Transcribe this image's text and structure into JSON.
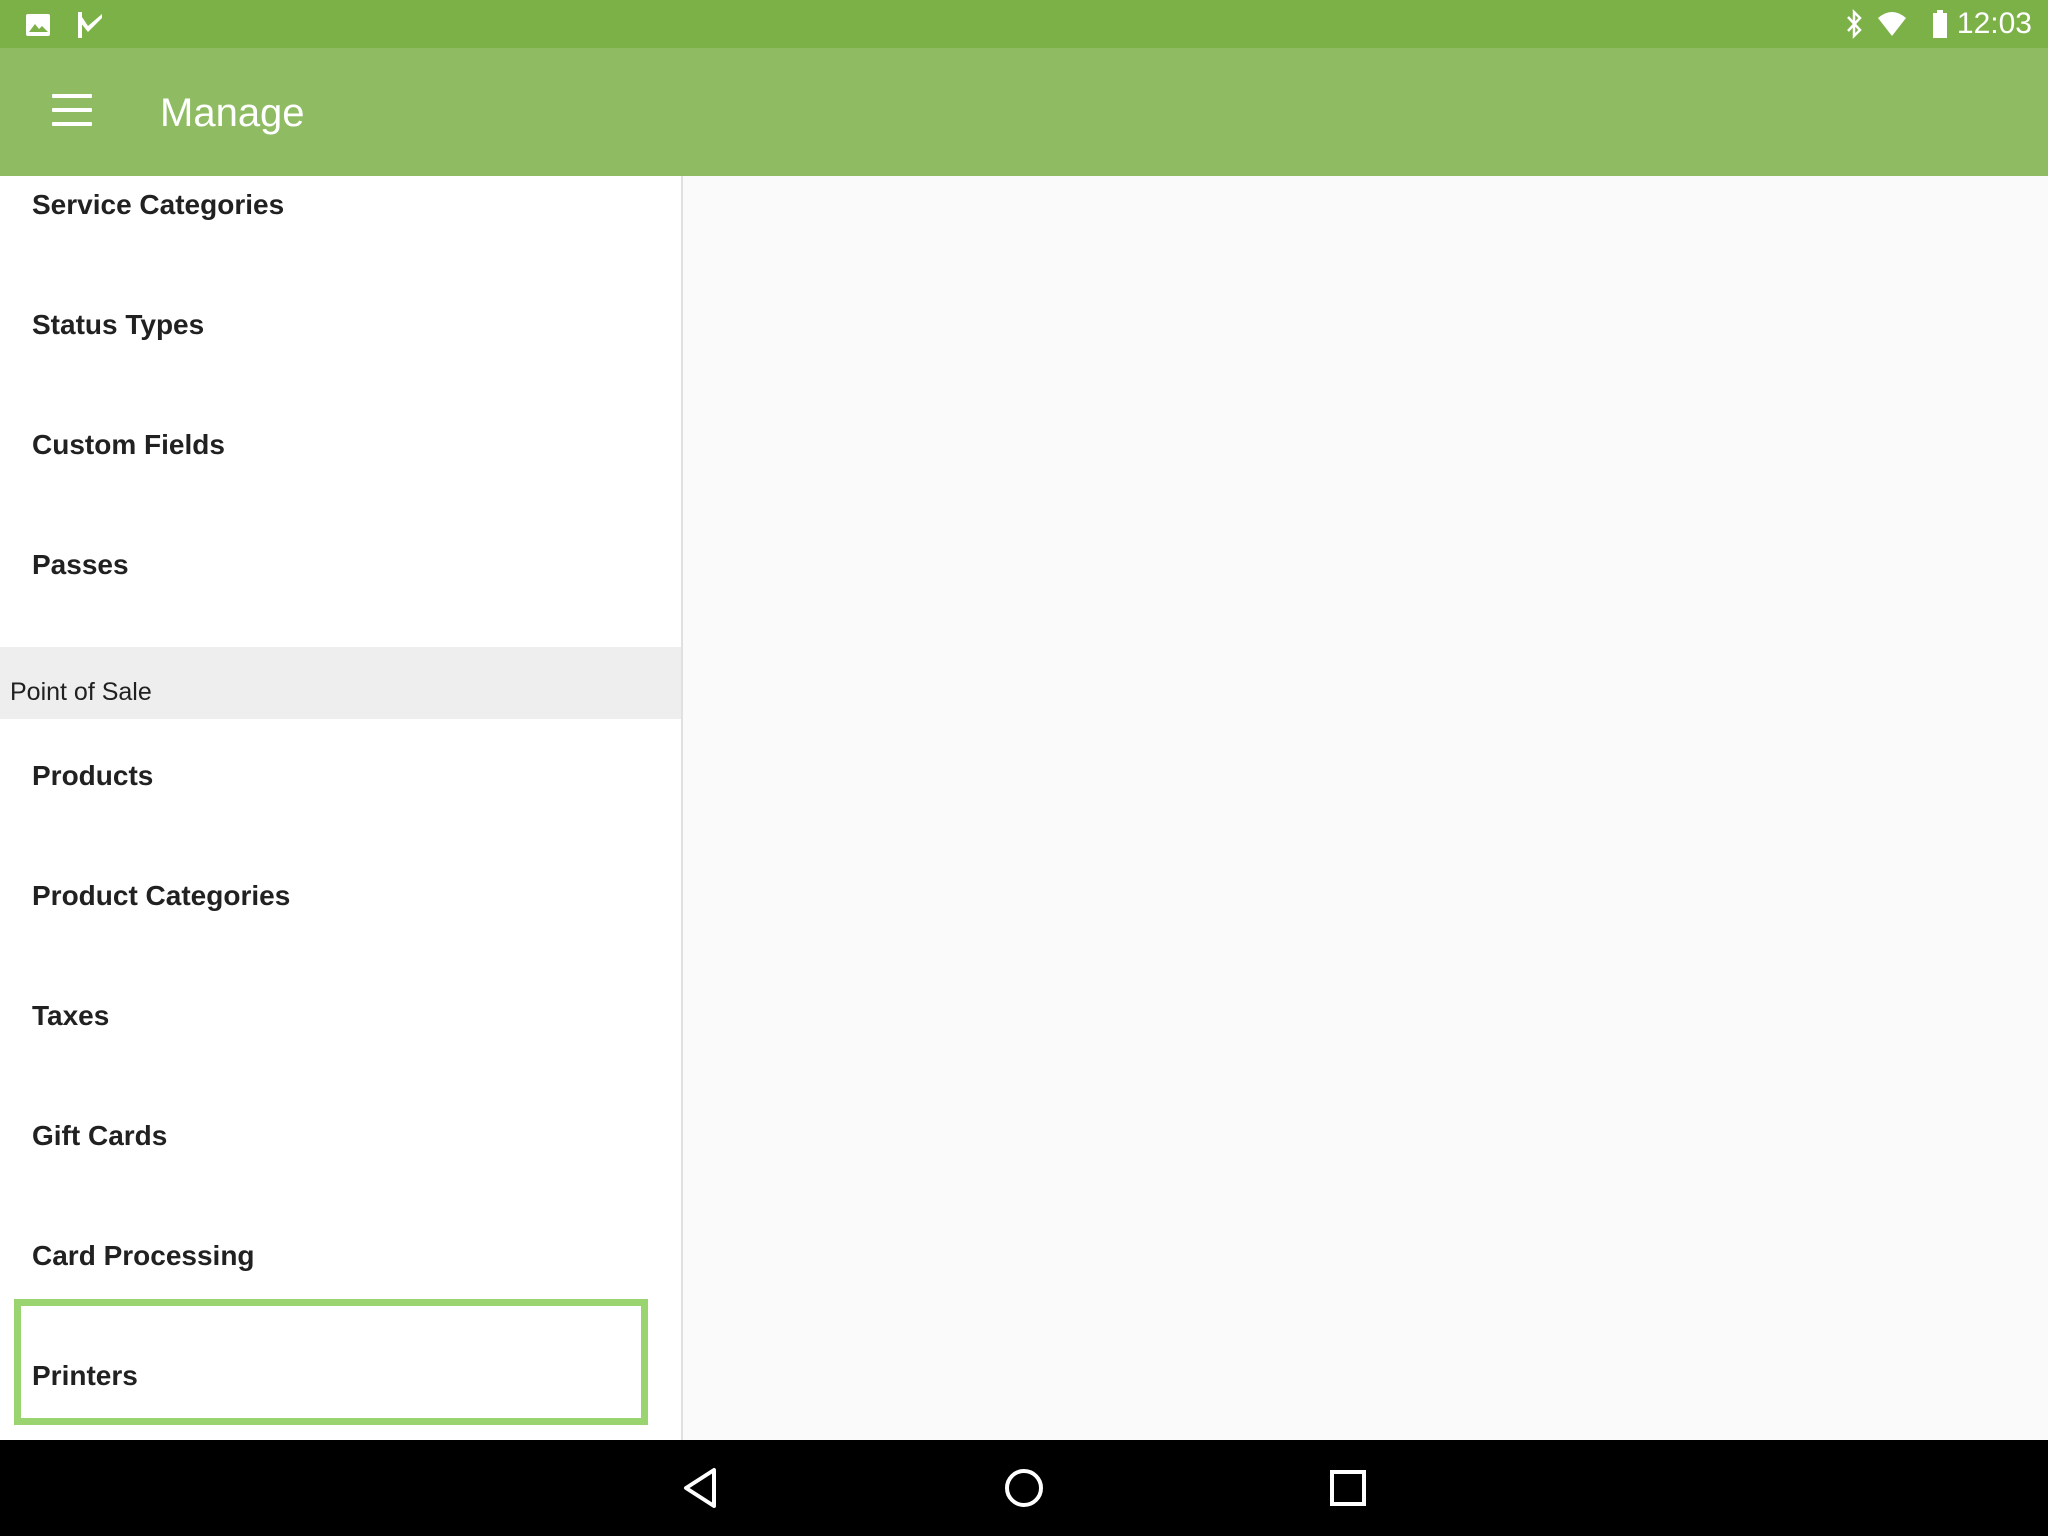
{
  "status_bar": {
    "time": "12:03",
    "left_icons": [
      "image-icon",
      "check-flag-icon"
    ],
    "right_icons": [
      "bluetooth-icon",
      "wifi-icon",
      "battery-icon"
    ],
    "color": "#7cb147"
  },
  "app_bar": {
    "title": "Manage",
    "color": "#8fbc62"
  },
  "list": {
    "items_top": [
      {
        "label": "Service Categories"
      },
      {
        "label": "Status Types"
      },
      {
        "label": "Custom Fields"
      },
      {
        "label": "Passes"
      }
    ],
    "section_header": "Point of Sale",
    "items_pos": [
      {
        "label": "Products"
      },
      {
        "label": "Product Categories"
      },
      {
        "label": "Taxes"
      },
      {
        "label": "Gift Cards"
      },
      {
        "label": "Card Processing"
      },
      {
        "label": "Printers"
      }
    ],
    "highlighted_item": "Printers",
    "highlight_color": "#99d470"
  },
  "nav_bar": {
    "buttons": [
      "back-icon",
      "home-icon",
      "recents-icon"
    ]
  }
}
